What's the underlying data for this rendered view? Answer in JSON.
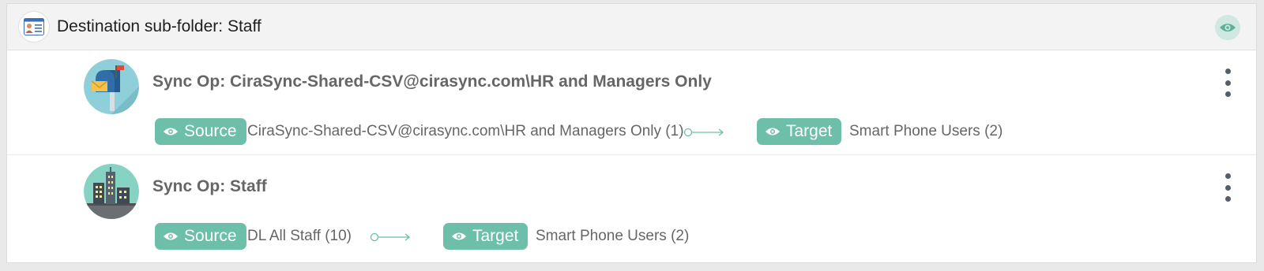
{
  "folder": {
    "title": "Destination sub-folder: Staff",
    "icon": "contact-card-icon",
    "accent": "#6dbfa9"
  },
  "sync_ops": [
    {
      "title": "Sync Op: CiraSync-Shared-CSV@cirasync.com\\HR and Managers Only",
      "avatar": "mailbox-icon",
      "source_label": "Source",
      "source_value": "CiraSync-Shared-CSV@cirasync.com\\HR and Managers Only (1)",
      "target_label": "Target",
      "target_value": "Smart Phone Users (2)"
    },
    {
      "title": "Sync Op: Staff",
      "avatar": "city-buildings-icon",
      "source_label": "Source",
      "source_value": "DL All Staff (10)",
      "target_label": "Target",
      "target_value": "Smart Phone Users (2)"
    }
  ]
}
